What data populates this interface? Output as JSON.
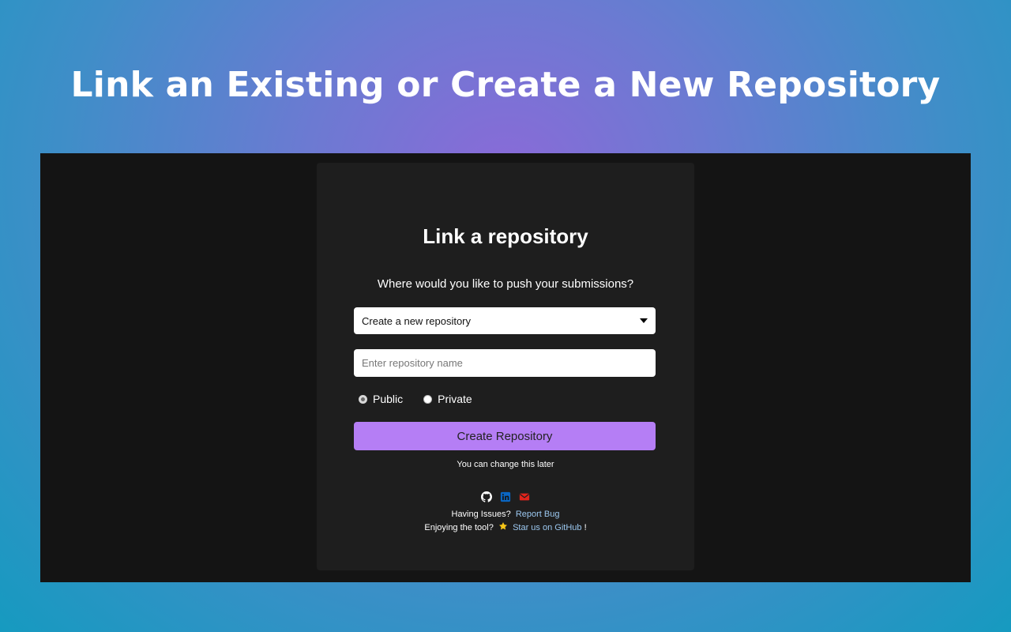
{
  "banner": {
    "title": "Link an Existing or Create a New Repository"
  },
  "card": {
    "title": "Link a repository",
    "question": "Where would you like to push your submissions?",
    "select": {
      "selected": "Create a new repository"
    },
    "repo_input": {
      "placeholder": "Enter repository name",
      "value": ""
    },
    "visibility": {
      "public_label": "Public",
      "private_label": "Private",
      "selected": "Public"
    },
    "create_button": "Create Repository",
    "hint": "You can change this later",
    "icons": [
      "github-icon",
      "linkedin-icon",
      "email-icon"
    ],
    "footer": {
      "issues_text": "Having Issues?",
      "report_link": "Report Bug",
      "enjoy_text": "Enjoying the tool?",
      "star_link": "Star us on GitHub",
      "exclaim": "!"
    }
  },
  "colors": {
    "accent_button": "#b57ef5",
    "card_bg": "#1e1e1e",
    "frame_bg": "#141414",
    "link": "#9cc8f0",
    "linkedin": "#0a66c2",
    "email": "#e0241c",
    "star": "#f5c518"
  }
}
